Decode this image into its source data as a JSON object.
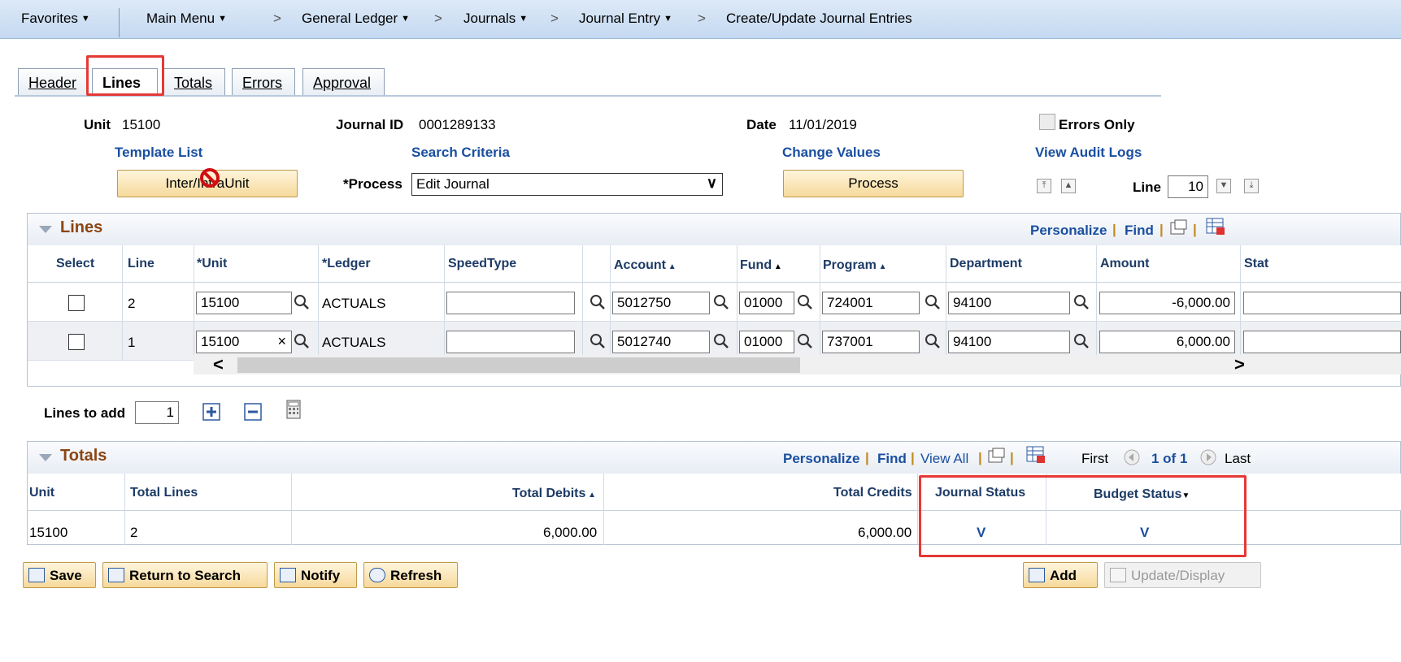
{
  "navbar": {
    "favorites": "Favorites",
    "main_menu": "Main Menu",
    "sep": ">",
    "general_ledger": "General Ledger",
    "journals": "Journals",
    "journal_entry": "Journal Entry",
    "current_page": "Create/Update Journal Entries"
  },
  "tabs": {
    "header": "Header",
    "lines": "Lines",
    "totals": "Totals",
    "errors": "Errors",
    "approval": "Approval"
  },
  "header_info": {
    "unit_label": "Unit",
    "unit_value": "15100",
    "journal_id_label": "Journal ID",
    "journal_id_value": "0001289133",
    "date_label": "Date",
    "date_value": "11/01/2019",
    "errors_only_label": "Errors Only",
    "template_list": "Template List",
    "search_criteria": "Search Criteria",
    "change_values": "Change Values",
    "view_audit_logs": "View Audit Logs",
    "inter_intra_unit": "Inter/IntraUnit",
    "process_label": "*Process",
    "process_value": "Edit Journal",
    "process_button": "Process",
    "line_label": "Line",
    "line_value": "10"
  },
  "lines_grid": {
    "title": "Lines",
    "personalize": "Personalize",
    "find": "Find",
    "pipe": "|",
    "columns": {
      "select": "Select",
      "line": "Line",
      "unit": "*Unit",
      "ledger": "*Ledger",
      "speedtype": "SpeedType",
      "account": "Account",
      "fund": "Fund",
      "program": "Program",
      "department": "Department",
      "amount": "Amount",
      "status": "Stat"
    },
    "rows": [
      {
        "line": "2",
        "unit": "15100",
        "ledger": "ACTUALS",
        "speedtype": "",
        "account": "5012750",
        "fund": "01000",
        "program": "724001",
        "department": "94100",
        "amount": "-6,000.00"
      },
      {
        "line": "1",
        "unit": "15100",
        "ledger": "ACTUALS",
        "speedtype": "",
        "account": "5012740",
        "fund": "01000",
        "program": "737001",
        "department": "94100",
        "amount": "6,000.00"
      }
    ]
  },
  "lines_to_add": {
    "label": "Lines to add",
    "value": "1"
  },
  "totals_grid": {
    "title": "Totals",
    "personalize": "Personalize",
    "find": "Find",
    "view_all": "View All",
    "pipe": "|",
    "first": "First",
    "range": "1 of 1",
    "last": "Last",
    "columns": {
      "unit": "Unit",
      "total_lines": "Total Lines",
      "total_debits": "Total Debits",
      "total_credits": "Total Credits",
      "journal_status": "Journal Status",
      "budget_status": "Budget Status"
    },
    "row": {
      "unit": "15100",
      "total_lines": "2",
      "total_debits": "6,000.00",
      "total_credits": "6,000.00",
      "journal_status": "V",
      "budget_status": "V"
    }
  },
  "footer": {
    "save": "Save",
    "return_to_search": "Return to Search",
    "notify": "Notify",
    "refresh": "Refresh",
    "add": "Add",
    "update_display": "Update/Display"
  },
  "colors": {
    "highlight": "#e53935",
    "link": "#1a4fa0",
    "grid_title": "#8b4513",
    "button_bg": "#f6d99b"
  }
}
